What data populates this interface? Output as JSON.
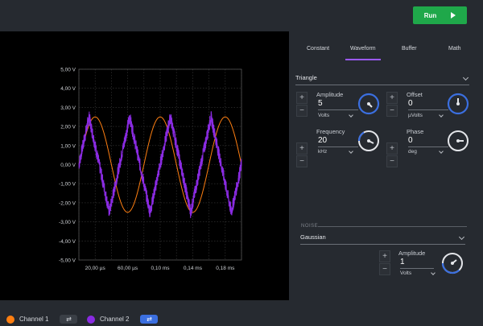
{
  "toolbar": {
    "run_label": "Run",
    "play_icon": "play-icon"
  },
  "tabs": [
    {
      "label": "Constant"
    },
    {
      "label": "Waveform",
      "active": true
    },
    {
      "label": "Buffer"
    },
    {
      "label": "Math"
    }
  ],
  "waveform": {
    "type": "Triangle",
    "amplitude": {
      "label": "Amplitude",
      "value": "5",
      "unit": "Volts"
    },
    "offset": {
      "label": "Offset",
      "value": "0",
      "unit": "µVolts"
    },
    "frequency": {
      "label": "Frequency",
      "value": "20",
      "unit": "kHz"
    },
    "phase": {
      "label": "Phase",
      "value": "0",
      "unit": "deg"
    }
  },
  "noise": {
    "section_label": "NOISE",
    "type": "Gaussian",
    "amplitude": {
      "label": "Amplitude",
      "value": "1",
      "unit": "Volts"
    }
  },
  "channels": [
    {
      "label": "Channel 1",
      "color": "#ff7f11",
      "enabled": false
    },
    {
      "label": "Channel 2",
      "color": "#8a2be2",
      "enabled": true
    }
  ],
  "colors": {
    "accent": "#9b59ff",
    "run": "#1fa84a",
    "knob_ring": "#3b6fe0"
  },
  "chart_data": {
    "type": "line",
    "yticks": [
      "5,00 V",
      "4,00 V",
      "3,00 V",
      "2,00 V",
      "1,00 V",
      "0,00 V",
      "-1,00 V",
      "-2,00 V",
      "-3,00 V",
      "-4,00 V",
      "-5,00 V"
    ],
    "xticks": [
      "20,00 µs",
      "60,00 µs",
      "0,10 ms",
      "0,14 ms",
      "0,18 ms"
    ],
    "xlim": [
      0,
      0.2
    ],
    "ylim": [
      -5,
      5
    ],
    "grid": true,
    "series": [
      {
        "color": "#ff7f11",
        "shape": "sine",
        "amplitude": 2.5,
        "period": 0.08,
        "x_unit": "ms"
      },
      {
        "color": "#8a2be2",
        "shape": "triangle",
        "amplitude": 2.5,
        "period": 0.05,
        "noise_amplitude": 0.35,
        "x_unit": "ms"
      }
    ]
  }
}
